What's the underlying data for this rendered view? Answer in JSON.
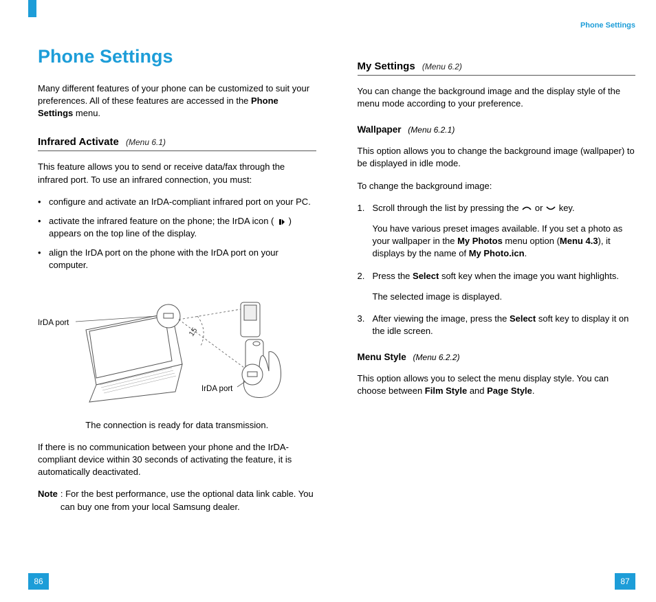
{
  "runningHead": "Phone Settings",
  "title": "Phone Settings",
  "intro": {
    "pre": "Many different features of your phone can be customized to suit your preferences. All of these features are accessed in the ",
    "bold": "Phone Settings",
    "post": " menu."
  },
  "sec1": {
    "heading": "Infrared Activate",
    "menuRef": "(Menu 6.1)",
    "p1": "This feature allows you to send or receive data/fax through the infrared port. To use an infrared connection, you must:",
    "bullets": {
      "b1": "configure and activate an IrDA-compliant infrared port on your PC.",
      "b2pre": "activate the infrared feature on the phone; the IrDA icon ( ",
      "b2post": " ) appears on the top line of the display.",
      "b3": "align the IrDA port on the phone with the IrDA port on your computer."
    },
    "figLabel1": "IrDA port",
    "figLabel2": "IrDA port",
    "figAngle": "15",
    "figCaption": "The connection is ready for data transmission.",
    "p2": "If there is no communication between your phone and the IrDA-compliant device within 30 seconds of activating the feature, it is automatically deactivated.",
    "noteLabel": "Note",
    "noteText": ": For the best performance, use the optional data link cable. You can buy one from your local Samsung dealer."
  },
  "sec2": {
    "heading": "My Settings",
    "menuRef": "(Menu 6.2)",
    "p1": "You can change the background image and the display style of the menu mode according to your preference.",
    "sub1": {
      "heading": "Wallpaper",
      "menuRef": "(Menu 6.2.1)",
      "p1": "This option allows you to change the background image (wallpaper) to be displayed in idle mode.",
      "p2": "To change the background image:",
      "step1pre": "Scroll through the list by pressing the ",
      "step1mid": " or ",
      "step1post": " key.",
      "step1para_a": "You have various preset images available. If you set a photo as your wallpaper in the ",
      "step1para_b": "My Photos",
      "step1para_c": " menu option (",
      "step1para_d": "Menu 4.3",
      "step1para_e": "), it displays by the name of ",
      "step1para_f": "My Photo.icn",
      "step1para_g": ".",
      "step2a": "Press the ",
      "step2b": "Select",
      "step2c": " soft key when the image you want highlights.",
      "step2para": "The selected image is displayed.",
      "step3a": "After viewing the image, press the ",
      "step3b": "Select",
      "step3c": " soft key to display it on the idle screen."
    },
    "sub2": {
      "heading": "Menu Style",
      "menuRef": "(Menu 6.2.2)",
      "p_a": "This option allows you to select the menu display style. You can choose between ",
      "p_b": "Film Style",
      "p_c": " and ",
      "p_d": "Page Style",
      "p_e": "."
    }
  },
  "pageLeft": "86",
  "pageRight": "87"
}
